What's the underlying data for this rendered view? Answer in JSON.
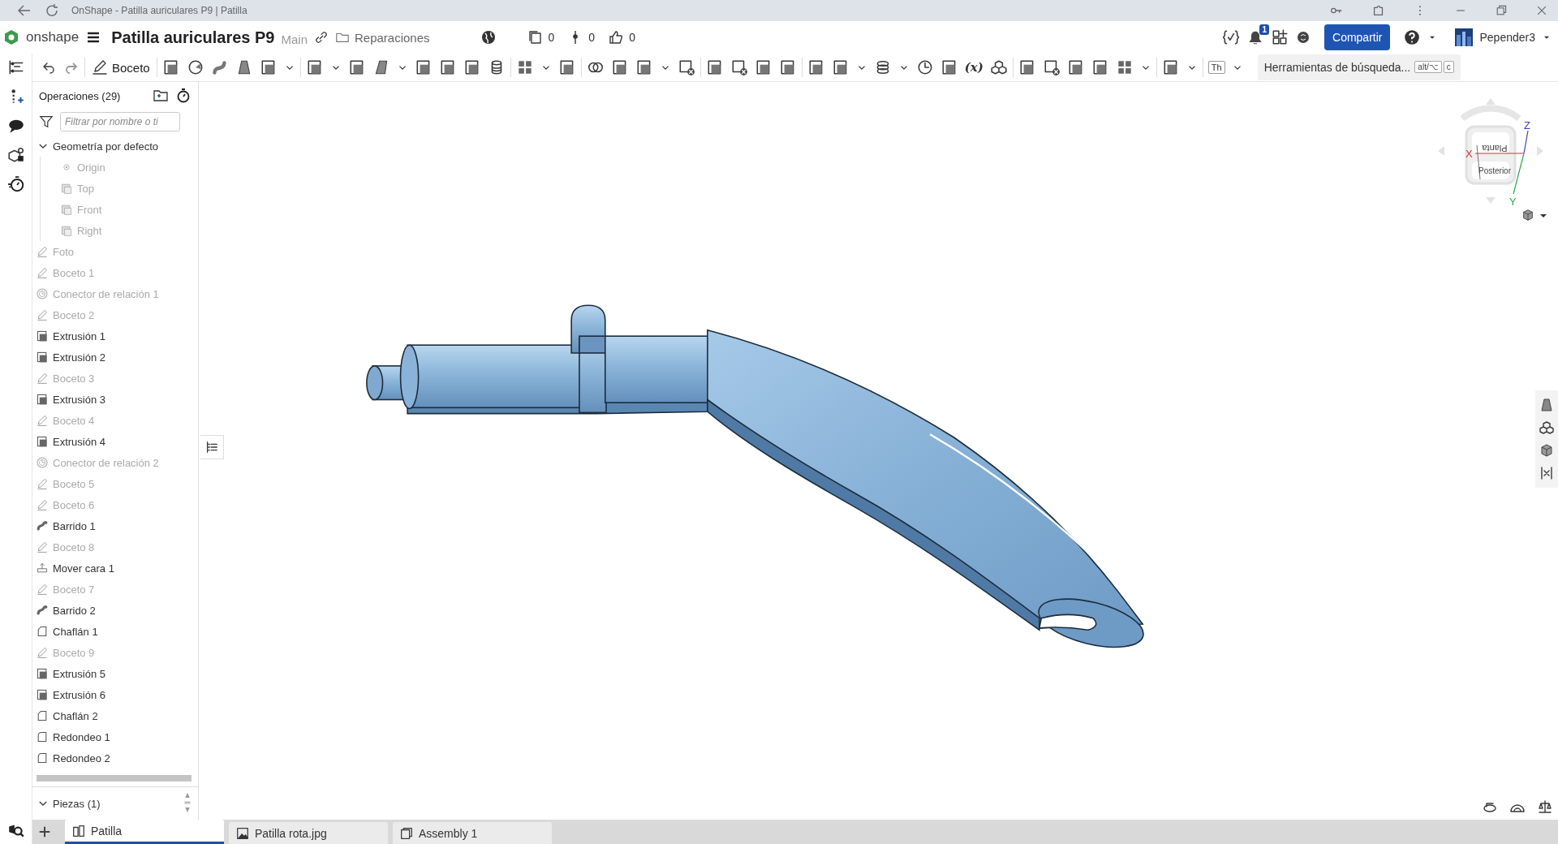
{
  "browser": {
    "title": "OnShape - Patilla auriculares P9 | Patilla"
  },
  "header": {
    "logo": "onshape",
    "document_title": "Patilla auriculares P9",
    "branch": "Main",
    "folder": "Reparaciones",
    "counters": [
      {
        "kind": "versions",
        "value": "0"
      },
      {
        "kind": "branches",
        "value": "0"
      },
      {
        "kind": "likes",
        "value": "0"
      }
    ],
    "notifications": "1",
    "share_button": "Compartir",
    "user": "Pepender3"
  },
  "toolbar": {
    "sketch_button": "Boceto",
    "variable_glyph": "(x)",
    "text_tool": "Th",
    "search": {
      "placeholder": "Herramientas de búsqueda...",
      "shortcut_keys": [
        "alt/⌥",
        "c"
      ]
    }
  },
  "feature_panel": {
    "title": "Operaciones (29)",
    "filter": {
      "placeholder": "Filtrar por nombre o ti"
    },
    "features": [
      {
        "label": "Geometría por defecto",
        "kind": "group",
        "expanded": true,
        "children": [
          {
            "label": "Origin",
            "kind": "origin",
            "hidden": true
          },
          {
            "label": "Top",
            "kind": "plane",
            "hidden": true
          },
          {
            "label": "Front",
            "kind": "plane",
            "hidden": true
          },
          {
            "label": "Right",
            "kind": "plane",
            "hidden": true
          }
        ]
      },
      {
        "label": "Foto",
        "kind": "sketch",
        "hidden": true
      },
      {
        "label": "Boceto 1",
        "kind": "sketch",
        "hidden": true
      },
      {
        "label": "Conector de relación 1",
        "kind": "connector",
        "hidden": true
      },
      {
        "label": "Boceto 2",
        "kind": "sketch",
        "hidden": true
      },
      {
        "label": "Extrusión 1",
        "kind": "extrude",
        "hidden": false
      },
      {
        "label": "Extrusión 2",
        "kind": "extrude",
        "hidden": false
      },
      {
        "label": "Boceto 3",
        "kind": "sketch",
        "hidden": true
      },
      {
        "label": "Extrusión 3",
        "kind": "extrude",
        "hidden": false
      },
      {
        "label": "Boceto 4",
        "kind": "sketch",
        "hidden": true
      },
      {
        "label": "Extrusión 4",
        "kind": "extrude",
        "hidden": false
      },
      {
        "label": "Conector de relación 2",
        "kind": "connector",
        "hidden": true
      },
      {
        "label": "Boceto 5",
        "kind": "sketch",
        "hidden": true
      },
      {
        "label": "Boceto 6",
        "kind": "sketch",
        "hidden": true
      },
      {
        "label": "Barrido 1",
        "kind": "sweep",
        "hidden": false
      },
      {
        "label": "Boceto 8",
        "kind": "sketch",
        "hidden": true
      },
      {
        "label": "Mover cara 1",
        "kind": "move",
        "hidden": false
      },
      {
        "label": "Boceto 7",
        "kind": "sketch",
        "hidden": true
      },
      {
        "label": "Barrido 2",
        "kind": "sweep",
        "hidden": false
      },
      {
        "label": "Chaflán 1",
        "kind": "chamfer",
        "hidden": false
      },
      {
        "label": "Boceto 9",
        "kind": "sketch",
        "hidden": true
      },
      {
        "label": "Extrusión 5",
        "kind": "extrude",
        "hidden": false
      },
      {
        "label": "Extrusión 6",
        "kind": "extrude",
        "hidden": false
      },
      {
        "label": "Chaflán 2",
        "kind": "chamfer",
        "hidden": false
      },
      {
        "label": "Redondeo 1",
        "kind": "fillet",
        "hidden": false
      },
      {
        "label": "Redondeo 2",
        "kind": "fillet",
        "hidden": false
      }
    ],
    "parts": {
      "title": "Piezas (1)",
      "expanded": true
    }
  },
  "view_cube": {
    "faces": [
      "Planta",
      "Posterior"
    ],
    "axes": [
      {
        "label": "X",
        "color": "#d9303a"
      },
      {
        "label": "Y",
        "color": "#2fa84a"
      },
      {
        "label": "Z",
        "color": "#3a3fc4"
      }
    ]
  },
  "tabs": [
    {
      "label": "Patilla",
      "kind": "partstudio",
      "selected": true
    },
    {
      "label": "Patilla rota.jpg",
      "kind": "image",
      "selected": false
    },
    {
      "label": "Assembly 1",
      "kind": "assembly",
      "selected": false
    }
  ]
}
